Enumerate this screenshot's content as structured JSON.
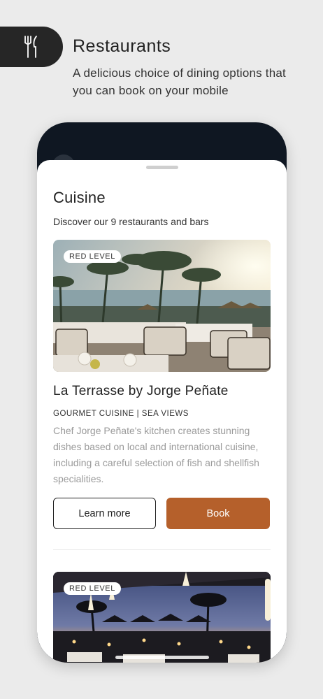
{
  "promo": {
    "icon": "cutlery-icon",
    "title": "Restaurants",
    "subtitle": "A delicious choice of dining options that you can book on your mobile"
  },
  "sheet": {
    "title": "Cuisine",
    "subtitle": "Discover our 9 restaurants and bars"
  },
  "restaurants": [
    {
      "badge": "RED LEVEL",
      "name": "La Terrasse by Jorge Peñate",
      "tags": "GOURMET CUISINE | SEA VIEWS",
      "description": "Chef Jorge Peñate's kitchen creates stunning dishes based on local and international cuisine, including a careful selection of fish and shellfish specialities.",
      "learn_more_label": "Learn more",
      "book_label": "Book"
    },
    {
      "badge": "RED LEVEL"
    }
  ],
  "colors": {
    "book_button": "#b5602b",
    "icon_pill": "#262626",
    "phone_frame": "#0f1722"
  }
}
